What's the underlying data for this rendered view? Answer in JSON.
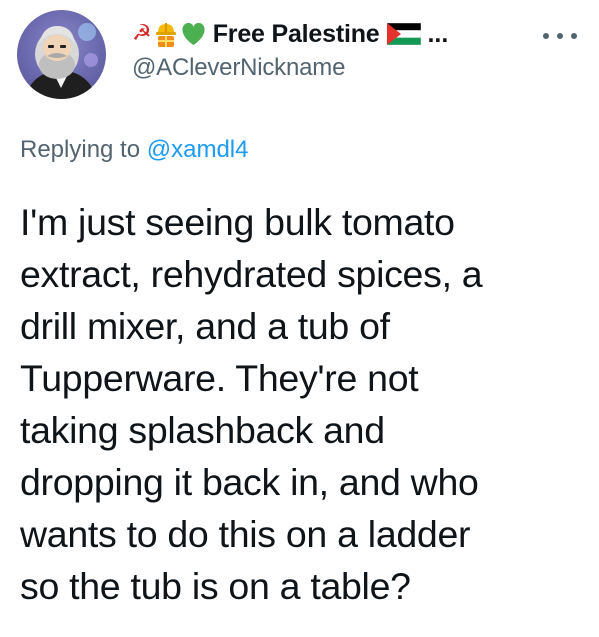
{
  "author": {
    "display_name": "Free Palestine",
    "name_prefix_icons": [
      "hammer-sickle-icon",
      "construction-worker-icon",
      "green-heart-icon"
    ],
    "name_suffix_icon": "palestine-flag-icon",
    "truncation": "...",
    "handle": "@ACleverNickname",
    "avatar": "avatar-cartoon-bearded-man"
  },
  "reply": {
    "prefix": "Replying to",
    "mention": "@xamdl4"
  },
  "tweet": {
    "lines": [
      "I'm just seeing bulk tomato",
      "extract, rehydrated spices, a",
      "drill mixer, and a tub of",
      "Tupperware. They're not",
      "taking splashback and",
      "dropping it back in, and who",
      "wants to do this on a ladder",
      "so the tub is on a table?"
    ]
  },
  "more_icon": "more-horizontal-icon",
  "colors": {
    "text": "#0f1419",
    "secondary": "#536471",
    "link": "#1d9bf0",
    "heart": "#4caf50",
    "flag_red": "#e4312b",
    "flag_green": "#149954"
  }
}
